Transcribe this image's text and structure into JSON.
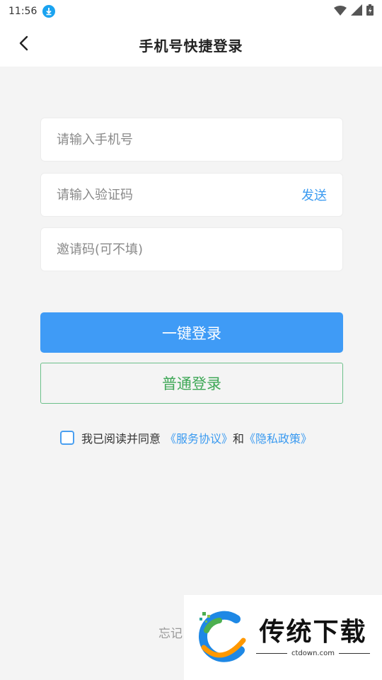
{
  "status_bar": {
    "time": "11:56"
  },
  "header": {
    "title": "手机号快捷登录"
  },
  "form": {
    "phone_placeholder": "请输入手机号",
    "code_placeholder": "请输入验证码",
    "send_label": "发送",
    "invite_placeholder": "邀请码(可不填)"
  },
  "actions": {
    "one_click_login": "一键登录",
    "normal_login": "普通登录"
  },
  "agreement": {
    "prefix": "我已阅读并同意",
    "service_link": "《服务协议》",
    "conjunction": "和",
    "privacy_link": "《隐私政策》"
  },
  "footer": {
    "forgot_partial": "忘记"
  },
  "watermark": {
    "brand": "传统下载",
    "site": "ctdown.com"
  },
  "colors": {
    "accent_blue": "#3f9bf6",
    "link_blue": "#3a9af0",
    "green": "#3fa857",
    "background": "#f4f4f4"
  },
  "icons": [
    "download-status-icon",
    "wifi-icon",
    "signal-icon",
    "battery-icon",
    "back-arrow-icon"
  ]
}
